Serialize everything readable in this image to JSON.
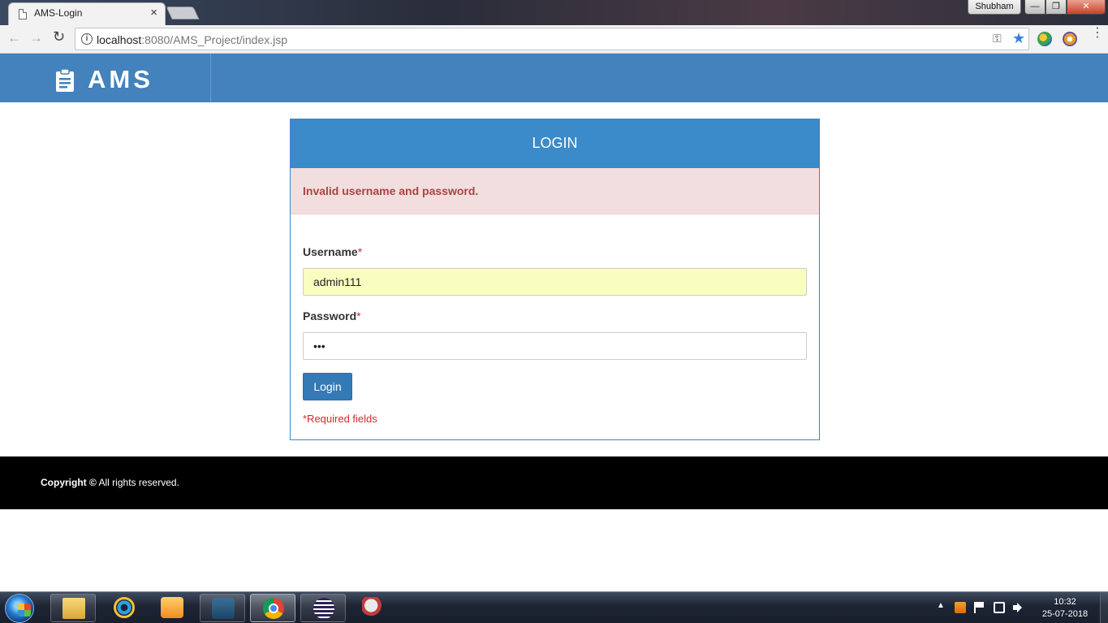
{
  "browser": {
    "tab_title": "AMS-Login",
    "tab_close": "×",
    "profile_name": "Shubham",
    "window_min": "—",
    "window_max": "❐",
    "window_close": "✕",
    "nav_back": "←",
    "nav_forward": "→",
    "nav_reload": "↻",
    "info_glyph": "i",
    "url_host": "localhost",
    "url_rest": ":8080/AMS_Project/index.jsp",
    "key_glyph": "⚿",
    "star_glyph": "★",
    "menu_glyph": "⋮",
    "icons": [
      "page-icon",
      "info-icon",
      "key-icon",
      "bookmark-star-icon",
      "extension-icon",
      "menu-icon"
    ]
  },
  "header": {
    "brand": "AMS",
    "brand_icon": "clipboard-icon",
    "color": "#4382bc"
  },
  "login": {
    "title": "LOGIN",
    "error": "Invalid username and password.",
    "username_label": "Username",
    "password_label": "Password",
    "required_star": "*",
    "username_value": "admin111",
    "password_value": "•••",
    "submit_label": "Login",
    "required_note": "*Required fields",
    "colors": {
      "panel_head": "#3b8ac9",
      "alert_bg": "#f2dede",
      "alert_text": "#a94442",
      "button": "#337ab7",
      "required": "#d9272e"
    }
  },
  "footer": {
    "copyright_bold": "Copyright ©",
    "copyright_rest": " All rights reserved."
  },
  "taskbar": {
    "apps": [
      "windows-explorer-icon",
      "internet-explorer-icon",
      "media-player-icon",
      "mysql-workbench-icon",
      "chrome-icon",
      "eclipse-icon",
      "snipping-tool-icon"
    ],
    "tray_arrow": "▲",
    "time": "10:32",
    "date": "25-07-2018"
  }
}
